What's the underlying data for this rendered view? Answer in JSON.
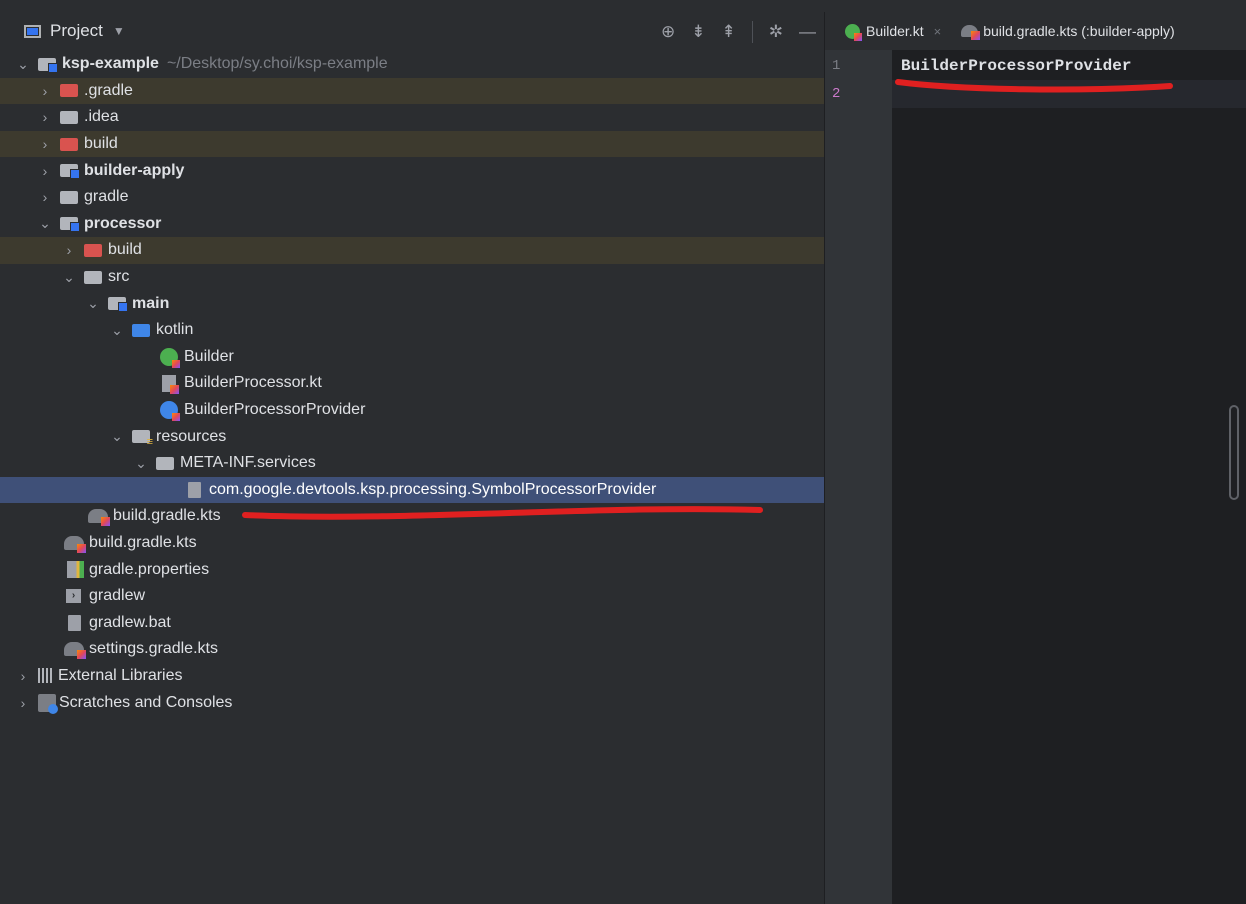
{
  "project_panel": {
    "title": "Project",
    "tree": [
      {
        "label": "ksp-example",
        "path": "~/Desktop/sy.choi/ksp-example"
      },
      {
        "label": ".gradle"
      },
      {
        "label": ".idea"
      },
      {
        "label": "build"
      },
      {
        "label": "builder-apply"
      },
      {
        "label": "gradle"
      },
      {
        "label": "processor"
      },
      {
        "label": "build"
      },
      {
        "label": "src"
      },
      {
        "label": "main"
      },
      {
        "label": "kotlin"
      },
      {
        "label": "Builder"
      },
      {
        "label": "BuilderProcessor.kt"
      },
      {
        "label": "BuilderProcessorProvider"
      },
      {
        "label": "resources"
      },
      {
        "label": "META-INF.services"
      },
      {
        "label": "com.google.devtools.ksp.processing.SymbolProcessorProvider"
      },
      {
        "label": "build.gradle.kts"
      },
      {
        "label": "build.gradle.kts"
      },
      {
        "label": "gradle.properties"
      },
      {
        "label": "gradlew"
      },
      {
        "label": "gradlew.bat"
      },
      {
        "label": "settings.gradle.kts"
      },
      {
        "label": "External Libraries"
      },
      {
        "label": "Scratches and Consoles"
      }
    ]
  },
  "editor": {
    "tabs": [
      {
        "label": "Builder.kt"
      },
      {
        "label": "build.gradle.kts (:builder-apply)"
      }
    ],
    "lines": [
      {
        "number": "1",
        "text": "BuilderProcessorProvider"
      },
      {
        "number": "2",
        "text": ""
      }
    ]
  },
  "colors": {
    "annotation": "#e02020",
    "selection": "#3f5078",
    "excluded_folder": "#d9534f"
  }
}
